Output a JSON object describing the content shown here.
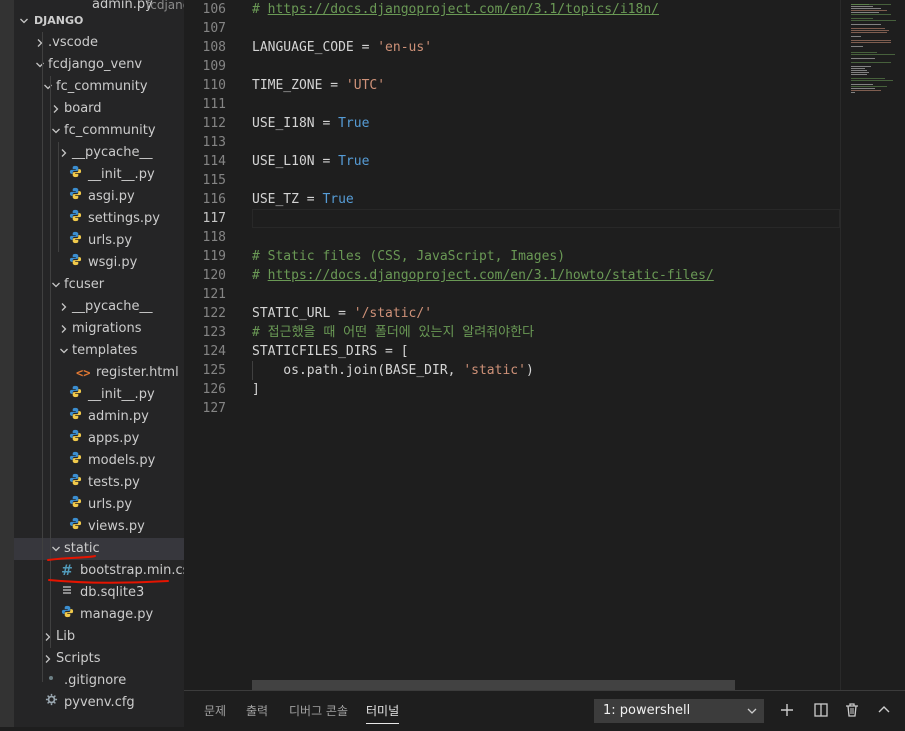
{
  "explorer": {
    "partial_top_item": "admin.py",
    "partial_top_suffix": "fcdjango...",
    "section_title": "DJANGO",
    "items": [
      {
        "label": ".vscode",
        "kind": "folder",
        "expanded": false
      },
      {
        "label": "fcdjango_venv",
        "kind": "folder",
        "expanded": true
      },
      {
        "label": "fc_community",
        "kind": "folder",
        "expanded": true
      },
      {
        "label": "board",
        "kind": "folder",
        "expanded": false
      },
      {
        "label": "fc_community",
        "kind": "folder",
        "expanded": true
      },
      {
        "label": "__pycache__",
        "kind": "folder",
        "expanded": false
      },
      {
        "label": "__init__.py",
        "kind": "python"
      },
      {
        "label": "asgi.py",
        "kind": "python"
      },
      {
        "label": "settings.py",
        "kind": "python"
      },
      {
        "label": "urls.py",
        "kind": "python"
      },
      {
        "label": "wsgi.py",
        "kind": "python"
      },
      {
        "label": "fcuser",
        "kind": "folder",
        "expanded": true
      },
      {
        "label": "__pycache__",
        "kind": "folder",
        "expanded": false
      },
      {
        "label": "migrations",
        "kind": "folder",
        "expanded": false
      },
      {
        "label": "templates",
        "kind": "folder",
        "expanded": true
      },
      {
        "label": "register.html",
        "kind": "html"
      },
      {
        "label": "__init__.py",
        "kind": "python"
      },
      {
        "label": "admin.py",
        "kind": "python"
      },
      {
        "label": "apps.py",
        "kind": "python"
      },
      {
        "label": "models.py",
        "kind": "python"
      },
      {
        "label": "tests.py",
        "kind": "python"
      },
      {
        "label": "urls.py",
        "kind": "python"
      },
      {
        "label": "views.py",
        "kind": "python"
      },
      {
        "label": "static",
        "kind": "folder",
        "expanded": true,
        "selected": true
      },
      {
        "label": "bootstrap.min.css",
        "kind": "css"
      },
      {
        "label": "db.sqlite3",
        "kind": "db"
      },
      {
        "label": "manage.py",
        "kind": "python"
      },
      {
        "label": "Lib",
        "kind": "folder",
        "expanded": false
      },
      {
        "label": "Scripts",
        "kind": "folder",
        "expanded": false
      },
      {
        "label": ".gitignore",
        "kind": "git"
      },
      {
        "label": "pyvenv.cfg",
        "kind": "config"
      }
    ]
  },
  "editor": {
    "active_line": "117",
    "lines": [
      {
        "n": "106",
        "tokens": [
          {
            "t": "# ",
            "c": "comment"
          },
          {
            "t": "https://docs.djangoproject.com/en/3.1/topics/i18n/",
            "c": "url"
          }
        ]
      },
      {
        "n": "107",
        "tokens": []
      },
      {
        "n": "108",
        "tokens": [
          {
            "t": "LANGUAGE_CODE = ",
            "c": "var"
          },
          {
            "t": "'en-us'",
            "c": "string"
          }
        ]
      },
      {
        "n": "109",
        "tokens": []
      },
      {
        "n": "110",
        "tokens": [
          {
            "t": "TIME_ZONE = ",
            "c": "var"
          },
          {
            "t": "'UTC'",
            "c": "string"
          }
        ]
      },
      {
        "n": "111",
        "tokens": []
      },
      {
        "n": "112",
        "tokens": [
          {
            "t": "USE_I18N = ",
            "c": "var"
          },
          {
            "t": "True",
            "c": "const"
          }
        ]
      },
      {
        "n": "113",
        "tokens": []
      },
      {
        "n": "114",
        "tokens": [
          {
            "t": "USE_L10N = ",
            "c": "var"
          },
          {
            "t": "True",
            "c": "const"
          }
        ]
      },
      {
        "n": "115",
        "tokens": []
      },
      {
        "n": "116",
        "tokens": [
          {
            "t": "USE_TZ = ",
            "c": "var"
          },
          {
            "t": "True",
            "c": "const"
          }
        ]
      },
      {
        "n": "117",
        "tokens": []
      },
      {
        "n": "118",
        "tokens": []
      },
      {
        "n": "119",
        "tokens": [
          {
            "t": "# Static files (CSS, JavaScript, Images)",
            "c": "comment"
          }
        ]
      },
      {
        "n": "120",
        "tokens": [
          {
            "t": "# ",
            "c": "comment"
          },
          {
            "t": "https://docs.djangoproject.com/en/3.1/howto/static-files/",
            "c": "url"
          }
        ]
      },
      {
        "n": "121",
        "tokens": []
      },
      {
        "n": "122",
        "tokens": [
          {
            "t": "STATIC_URL = ",
            "c": "var"
          },
          {
            "t": "'/static/'",
            "c": "string"
          }
        ]
      },
      {
        "n": "123",
        "tokens": [
          {
            "t": "# 접근했을 때 어떤 폴더에 있는지 알려줘야한다",
            "c": "comment"
          }
        ]
      },
      {
        "n": "124",
        "tokens": [
          {
            "t": "STATICFILES_DIRS = [",
            "c": "var"
          }
        ]
      },
      {
        "n": "125",
        "tokens": [
          {
            "t": "    os.path.join(BASE_DIR, ",
            "c": "var"
          },
          {
            "t": "'static'",
            "c": "string"
          },
          {
            "t": ")",
            "c": "var"
          }
        ]
      },
      {
        "n": "126",
        "tokens": [
          {
            "t": "]",
            "c": "var"
          }
        ]
      },
      {
        "n": "127",
        "tokens": []
      }
    ]
  },
  "panel": {
    "tabs": [
      {
        "label": "문제",
        "active": false
      },
      {
        "label": "출력",
        "active": false
      },
      {
        "label": "디버그 콘솔",
        "active": false
      },
      {
        "label": "터미널",
        "active": true
      }
    ],
    "terminal_select": "1: powershell",
    "buttons": [
      "plus-icon",
      "split-icon",
      "trash-icon",
      "chevron-up-icon"
    ]
  },
  "colors": {
    "comment": "#6a9955",
    "string": "#ce9178",
    "const": "#569cd6",
    "text": "#d4d4d4",
    "python_blue": "#3b8ed0",
    "python_yellow": "#f0c94b",
    "html_orange": "#e37933",
    "css_blue": "#519aba",
    "annotation_red": "#e51400"
  }
}
